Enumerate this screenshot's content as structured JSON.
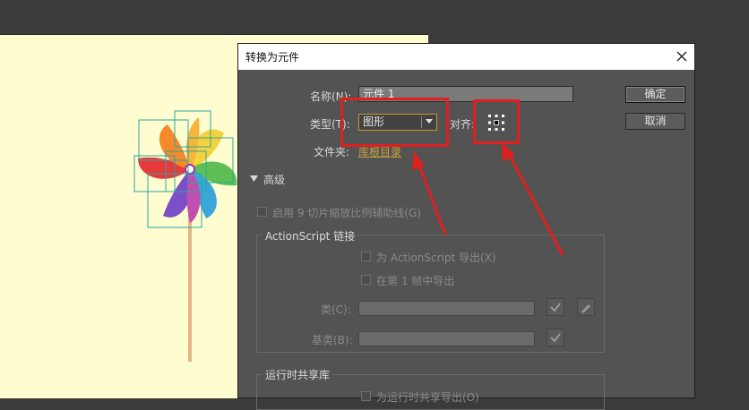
{
  "dialog": {
    "title": "转换为元件",
    "name_label": "名称(N):",
    "name_value": "元件 1",
    "type_label": "类型(T):",
    "type_value": "图形",
    "align_label": "对齐:",
    "folder_label": "文件夹:",
    "folder_value": "库根目录",
    "ok_label": "确定",
    "cancel_label": "取消",
    "advanced_label": "高级",
    "scale9_label": "启用 9 切片缩放比例辅助线(G)",
    "actionscript": {
      "title": "ActionScript 链接",
      "export_label": "为 ActionScript 导出(X)",
      "frame1_label": "在第 1 帧中导出",
      "class_label": "类(C):",
      "base_label": "基类(B):"
    },
    "runtime": {
      "title": "运行时共享库",
      "export_label": "为运行时共享导出(O)"
    }
  },
  "colors": {
    "stage_bg": "#fffdd0",
    "dialog_bg": "#535353",
    "annotation_red": "#e01f1f",
    "focus_border": "#c49a2e"
  }
}
